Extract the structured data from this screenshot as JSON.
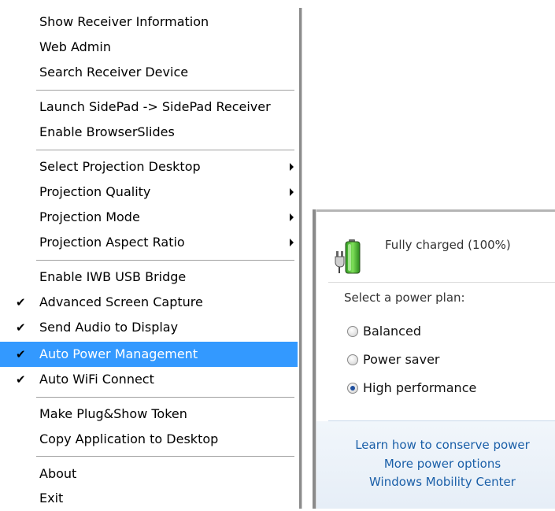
{
  "menu": {
    "items": [
      {
        "label": "Show Receiver Information",
        "checked": false,
        "submenu": false,
        "highlighted": false
      },
      {
        "label": "Web Admin",
        "checked": false,
        "submenu": false,
        "highlighted": false
      },
      {
        "label": "Search Receiver Device",
        "checked": false,
        "submenu": false,
        "highlighted": false
      },
      {
        "label": "Launch SidePad -> SidePad Receiver",
        "checked": false,
        "submenu": false,
        "highlighted": false
      },
      {
        "label": "Enable BrowserSlides",
        "checked": false,
        "submenu": false,
        "highlighted": false
      },
      {
        "label": "Select Projection Desktop",
        "checked": false,
        "submenu": true,
        "highlighted": false
      },
      {
        "label": "Projection Quality",
        "checked": false,
        "submenu": true,
        "highlighted": false
      },
      {
        "label": "Projection Mode",
        "checked": false,
        "submenu": true,
        "highlighted": false
      },
      {
        "label": "Projection Aspect Ratio",
        "checked": false,
        "submenu": true,
        "highlighted": false
      },
      {
        "label": "Enable IWB USB Bridge",
        "checked": false,
        "submenu": false,
        "highlighted": false
      },
      {
        "label": "Advanced Screen Capture",
        "checked": true,
        "submenu": false,
        "highlighted": false
      },
      {
        "label": "Send Audio to Display",
        "checked": true,
        "submenu": false,
        "highlighted": false
      },
      {
        "label": "Auto Power Management",
        "checked": true,
        "submenu": false,
        "highlighted": true
      },
      {
        "label": "Auto WiFi Connect",
        "checked": true,
        "submenu": false,
        "highlighted": false
      },
      {
        "label": "Make Plug&Show Token",
        "checked": false,
        "submenu": false,
        "highlighted": false
      },
      {
        "label": "Copy Application to Desktop",
        "checked": false,
        "submenu": false,
        "highlighted": false
      },
      {
        "label": "About",
        "checked": false,
        "submenu": false,
        "highlighted": false
      },
      {
        "label": "Exit",
        "checked": false,
        "submenu": false,
        "highlighted": false
      }
    ],
    "check_glyph": "✔",
    "highlight_color": "#3399ff"
  },
  "power": {
    "status": "Fully charged (100%)",
    "battery_icon": "battery-plugged-icon",
    "plan_title": "Select a power plan:",
    "plans": [
      {
        "label": "Balanced",
        "selected": false
      },
      {
        "label": "Power saver",
        "selected": false
      },
      {
        "label": "High performance",
        "selected": true
      }
    ],
    "links": [
      "Learn how to conserve power",
      "More power options",
      "Windows Mobility Center"
    ],
    "link_color": "#1a5fa8"
  }
}
